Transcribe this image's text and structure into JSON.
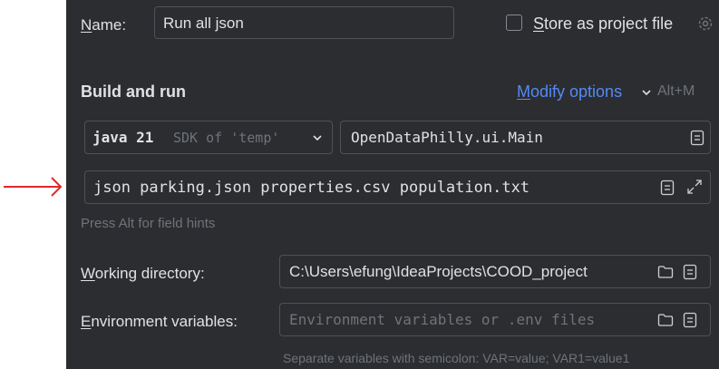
{
  "name_row": {
    "label_mnemonic": "N",
    "label_rest": "ame:",
    "value": "Run all json",
    "store_mnemonic": "S",
    "store_rest": "tore as project file"
  },
  "build_run": {
    "title": "Build and run",
    "modify_mnemonic": "M",
    "modify_rest": "odify options",
    "modify_shortcut": "Alt+M",
    "java_version": "java 21",
    "sdk_hint": "SDK of 'temp'",
    "main_class": "OpenDataPhilly.ui.Main",
    "program_args": "json parking.json properties.csv population.txt",
    "hint": "Press Alt for field hints"
  },
  "working_dir": {
    "label_mnemonic": "W",
    "label_rest": "orking directory:",
    "value": "C:\\Users\\efung\\IdeaProjects\\COOD_project"
  },
  "env": {
    "label_mnemonic": "E",
    "label_rest": "nvironment variables:",
    "placeholder": "Environment variables or .env files",
    "hint": "Separate variables with semicolon: VAR=value; VAR1=value1"
  },
  "colors": {
    "background": "#2b2d30",
    "link": "#548af7",
    "annotation_arrow": "#e0292b"
  },
  "icons": [
    "settings-icon",
    "chevron-down-icon",
    "document-icon",
    "expand-icon",
    "folder-icon",
    "arrow-right-icon"
  ]
}
